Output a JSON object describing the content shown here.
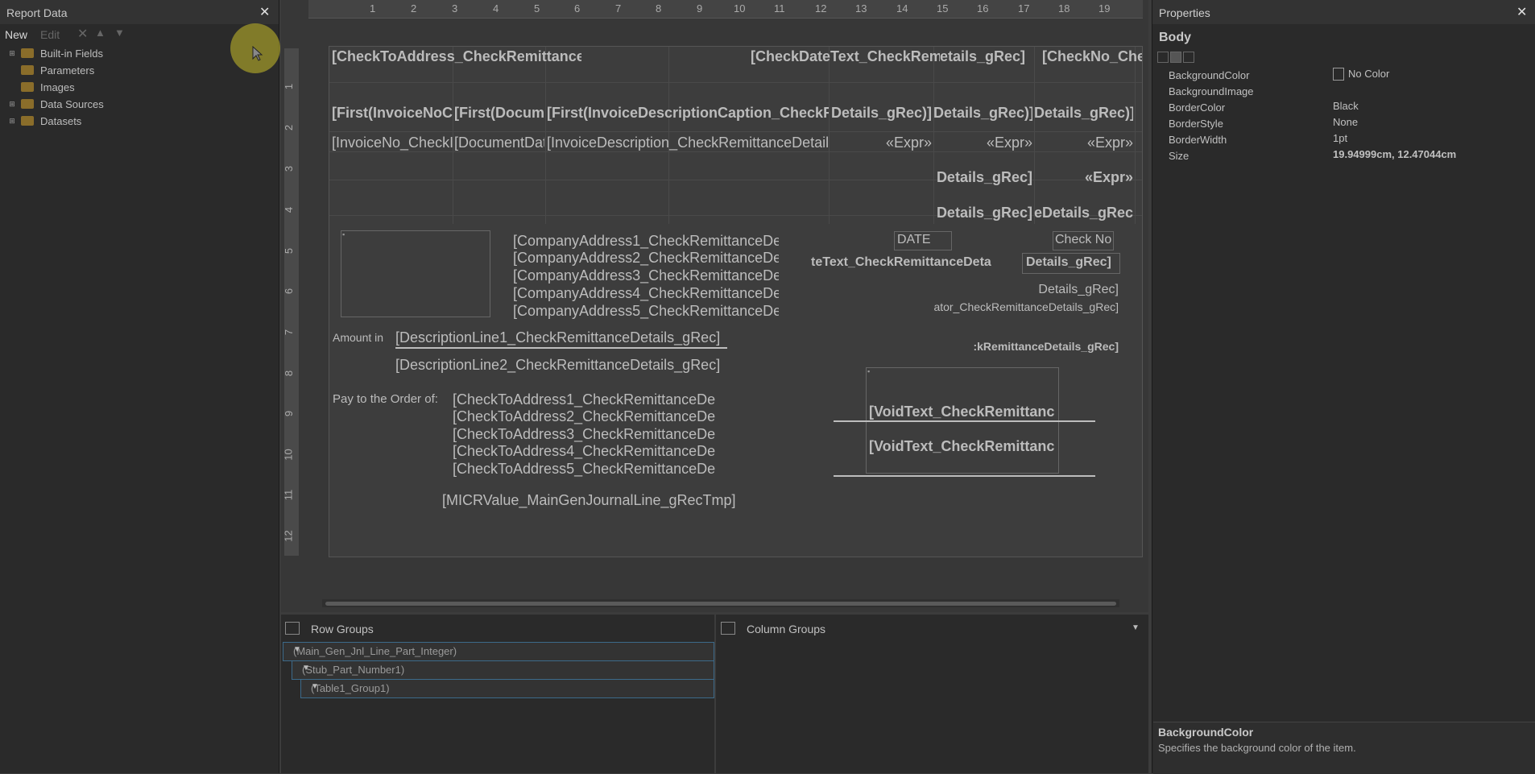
{
  "left_panel": {
    "title": "Report Data",
    "toolbar": {
      "new": "New",
      "edit": "Edit"
    },
    "items": [
      {
        "label": "Built-in Fields",
        "expandable": true
      },
      {
        "label": "Parameters",
        "expandable": false
      },
      {
        "label": "Images",
        "expandable": false
      },
      {
        "label": "Data Sources",
        "expandable": true
      },
      {
        "label": "Datasets",
        "expandable": true
      }
    ]
  },
  "ruler": {
    "top": [
      "1",
      "2",
      "3",
      "4",
      "5",
      "6",
      "7",
      "8",
      "9",
      "10",
      "11",
      "12",
      "13",
      "14",
      "15",
      "16",
      "17",
      "18",
      "19"
    ],
    "left": [
      "1",
      "2",
      "3",
      "4",
      "5",
      "6",
      "7",
      "8",
      "9",
      "10",
      "11",
      "12"
    ]
  },
  "report": {
    "row1": {
      "a": "[CheckToAddress_CheckRemittance",
      "b": "[CheckDateText_CheckRemit",
      "c": "etails_gRec]",
      "d": "[CheckNo_Che"
    },
    "row2": {
      "a": "[First(InvoiceNoC",
      "b": "[First(Docum",
      "c": "[First(InvoiceDescriptionCaption_CheckR",
      "d": "Details_gRec)]",
      "e": "Details_gRec)]",
      "f": "Details_gRec)]"
    },
    "row3": {
      "a": "[InvoiceNo_CheckI",
      "b": "[DocumentDat",
      "c": "[InvoiceDescription_CheckRemittanceDetails",
      "d": "«Expr»",
      "e": "«Expr»",
      "f": "«Expr»"
    },
    "row4": {
      "a": "Details_gRec]",
      "b": "«Expr»"
    },
    "row5": {
      "a": "Details_gRec]",
      "b": "eDetails_gRec]"
    },
    "company": [
      "[CompanyAddress1_CheckRemittanceDe",
      "[CompanyAddress2_CheckRemittanceDe",
      "[CompanyAddress3_CheckRemittanceDe",
      "[CompanyAddress4_CheckRemittanceDe",
      "[CompanyAddress5_CheckRemittanceDe"
    ],
    "date_label": "DATE",
    "checkno_label": "Check No",
    "date_text": "teText_CheckRemittanceDeta",
    "check_no_text": "Details_gRec]",
    "details_right": "Details_gRec]",
    "ator_text": "ator_CheckRemittanceDetails_gRec]",
    "kremit_text": ":kRemittanceDetails_gRec]",
    "amount_label": "Amount in",
    "desc1": "[DescriptionLine1_CheckRemittanceDetails_gRec]",
    "desc2": "[DescriptionLine2_CheckRemittanceDetails_gRec]",
    "pay_label": "Pay to the Order of:",
    "checkto": [
      "[CheckToAddress1_CheckRemittanceDe",
      "[CheckToAddress2_CheckRemittanceDe",
      "[CheckToAddress3_CheckRemittanceDe",
      "[CheckToAddress4_CheckRemittanceDe",
      "[CheckToAddress5_CheckRemittanceDe"
    ],
    "void1": "[VoidText_CheckRemittanc",
    "void2": "[VoidText_CheckRemittanc",
    "micr": "[MICRValue_MainGenJournalLine_gRecTmp]"
  },
  "groups": {
    "row_title": "Row Groups",
    "col_title": "Column Groups",
    "rows": [
      "(Main_Gen_Jnl_Line_Part_Integer)",
      "(Stub_Part_Number1)",
      "(Table1_Group1)"
    ]
  },
  "right_panel": {
    "title": "Properties",
    "object": "Body",
    "props": [
      {
        "name": "BackgroundColor",
        "value": "No Color"
      },
      {
        "name": "BackgroundImage",
        "value": ""
      },
      {
        "name": "BorderColor",
        "value": "Black"
      },
      {
        "name": "BorderStyle",
        "value": "None"
      },
      {
        "name": "BorderWidth",
        "value": "1pt"
      },
      {
        "name": "Size",
        "value": "19.94999cm, 12.47044cm"
      }
    ],
    "desc_title": "BackgroundColor",
    "desc_text": "Specifies the background color of the item."
  }
}
